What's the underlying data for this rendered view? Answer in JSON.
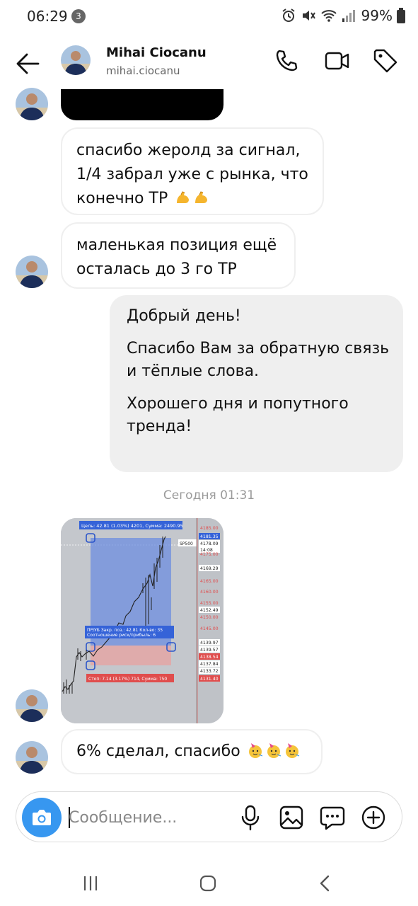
{
  "status_bar": {
    "time": "06:29",
    "notification_count": "3",
    "battery": "99%"
  },
  "header": {
    "name": "Mihai Ciocanu",
    "username": "mihai.ciocanu"
  },
  "messages": [
    {
      "direction": "incoming",
      "lines": [
        "спасибо жеролд за сигнал,",
        "1/4 забрал уже с рынка, что",
        "конечно ТР"
      ],
      "emoji": [
        "flexed-biceps",
        "flexed-biceps"
      ]
    },
    {
      "direction": "incoming",
      "lines": [
        "маленькая позиция ещё",
        "осталась до 3 го ТР"
      ]
    },
    {
      "direction": "outgoing",
      "lines": [
        "Добрый день!",
        "",
        "Спасибо Вам за обратную связь",
        "и тёплые слова.",
        "",
        "Хорошего дня и попутного",
        "тренда!"
      ]
    },
    {
      "direction": "incoming",
      "lines": [
        "6% сделал, спасибо"
      ],
      "emoji": [
        "partying-face",
        "partying-face",
        "partying-face"
      ]
    }
  ],
  "date_separator": "Сегодня 01:31",
  "chart_screenshot": {
    "target_label": "Цель: 42.81 (1.03%) 4201, Сумма: 2490.95",
    "symbol": "SP500",
    "position_label_1": "ПР/УБ Закр. поз.: 42.81  Кол-во: 35",
    "position_label_2": "Соотношение риск/прибыль: 6",
    "stop_label": "Стоп: 7.14 (3.17%) 714, Сумма: 750",
    "price_labels": [
      "4185.00",
      "4181.35",
      "4178.09",
      "14:08",
      "4175.00",
      "4169.29",
      "4165.00",
      "4160.00",
      "4155.00",
      "4152.49",
      "4150.00",
      "4145.00",
      "4139.97",
      "4139.57",
      "4138.54",
      "4137.84",
      "4133.72",
      "4131.40"
    ]
  },
  "composer": {
    "placeholder": "Сообщение..."
  },
  "icons": {
    "back": "arrow-left-icon",
    "call": "phone-icon",
    "video": "video-camera-icon",
    "tag": "tag-icon",
    "camera": "camera-icon",
    "mic": "microphone-icon",
    "gallery": "image-icon",
    "sticker": "chat-bubble-icon",
    "add": "plus-circle-icon"
  },
  "colors": {
    "accent": "#3797f0",
    "incoming_border": "#efefef",
    "outgoing_bg": "#efefef"
  }
}
